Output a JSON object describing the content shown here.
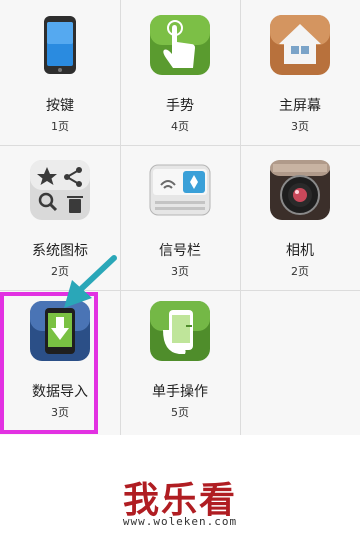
{
  "grid": {
    "items": [
      {
        "label": "按键",
        "pages": "1页",
        "icon": "phone-icon"
      },
      {
        "label": "手势",
        "pages": "4页",
        "icon": "hand-touch-icon"
      },
      {
        "label": "主屏幕",
        "pages": "3页",
        "icon": "home-icon"
      },
      {
        "label": "系统图标",
        "pages": "2页",
        "icon": "system-icons-icon"
      },
      {
        "label": "信号栏",
        "pages": "3页",
        "icon": "status-bar-icon"
      },
      {
        "label": "相机",
        "pages": "2页",
        "icon": "camera-icon"
      },
      {
        "label": "数据导入",
        "pages": "3页",
        "icon": "data-import-icon"
      },
      {
        "label": "单手操作",
        "pages": "5页",
        "icon": "one-hand-icon"
      }
    ],
    "selected_index": 6,
    "highlight_color": "#e231e2",
    "arrow_color": "#2aa7b8"
  },
  "banner": {
    "logo": "我乐看",
    "url": "www.woleken.com"
  }
}
